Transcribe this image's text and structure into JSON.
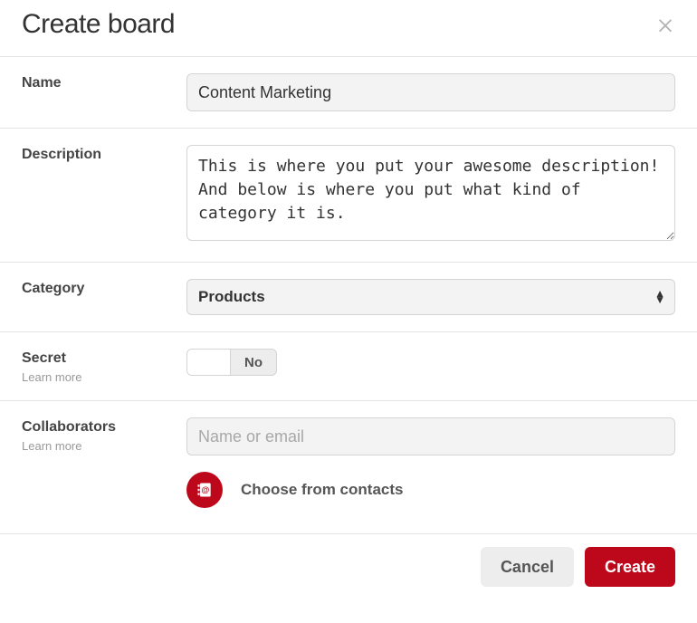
{
  "header": {
    "title": "Create board"
  },
  "fields": {
    "name": {
      "label": "Name",
      "value": "Content Marketing"
    },
    "description": {
      "label": "Description",
      "value": "This is where you put your awesome description! And below is where you put what kind of category it is."
    },
    "category": {
      "label": "Category",
      "selected": "Products"
    },
    "secret": {
      "label": "Secret",
      "learn": "Learn more",
      "state_label": "No",
      "value": false
    },
    "collaborators": {
      "label": "Collaborators",
      "learn": "Learn more",
      "placeholder": "Name or email",
      "contacts_label": "Choose from contacts"
    }
  },
  "footer": {
    "cancel": "Cancel",
    "create": "Create"
  },
  "colors": {
    "accent": "#bd081c"
  }
}
